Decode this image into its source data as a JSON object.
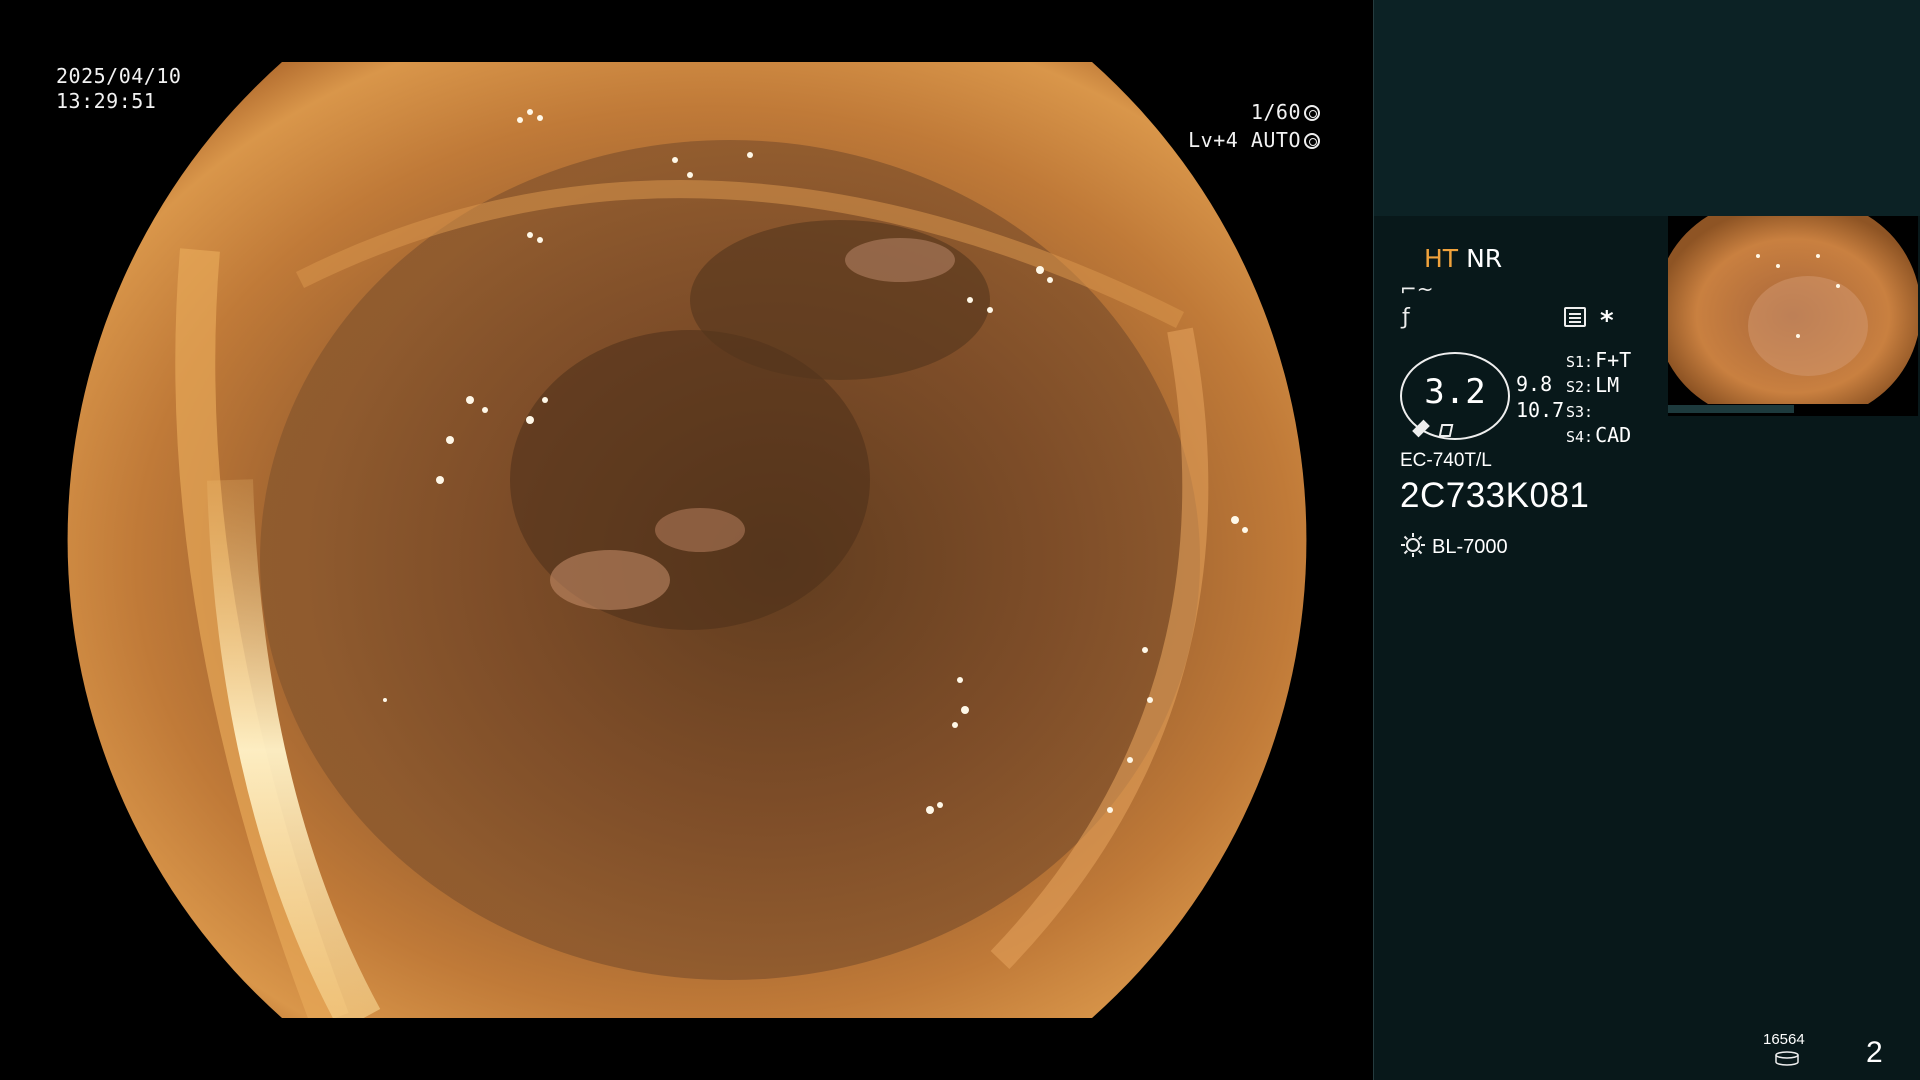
{
  "overlay": {
    "date": "2025/04/10",
    "time": "13:29:51",
    "shutter": "1/60",
    "level": "Lv+4",
    "mode": "AUTO"
  },
  "panel": {
    "ht": "HT",
    "nr": "NR",
    "zoom": "3.2",
    "value_a": "9.8",
    "value_b": "10.7",
    "settings": [
      {
        "key": "S1:",
        "value": "F+T"
      },
      {
        "key": "S2:",
        "value": "LM"
      },
      {
        "key": "S3:",
        "value": ""
      },
      {
        "key": "S4:",
        "value": "CAD"
      }
    ],
    "scope_model": "EC-740T/L",
    "scope_serial": "2C733K081",
    "light_source": "BL-7000",
    "count": "16564",
    "page": "2"
  },
  "icons": {
    "shutter": "shutter-icon",
    "mode": "auto-iris-icon",
    "enhance1": "edge-enhance-icon",
    "enhance2": "structure-enhance-icon",
    "memo": "memo-icon",
    "star": "asterisk-icon",
    "light": "lamp-icon",
    "storage": "disk-icon"
  },
  "colors": {
    "ht": "#f0a23c",
    "panel_bg": "#08181a",
    "panel_top": "#0c2225"
  }
}
